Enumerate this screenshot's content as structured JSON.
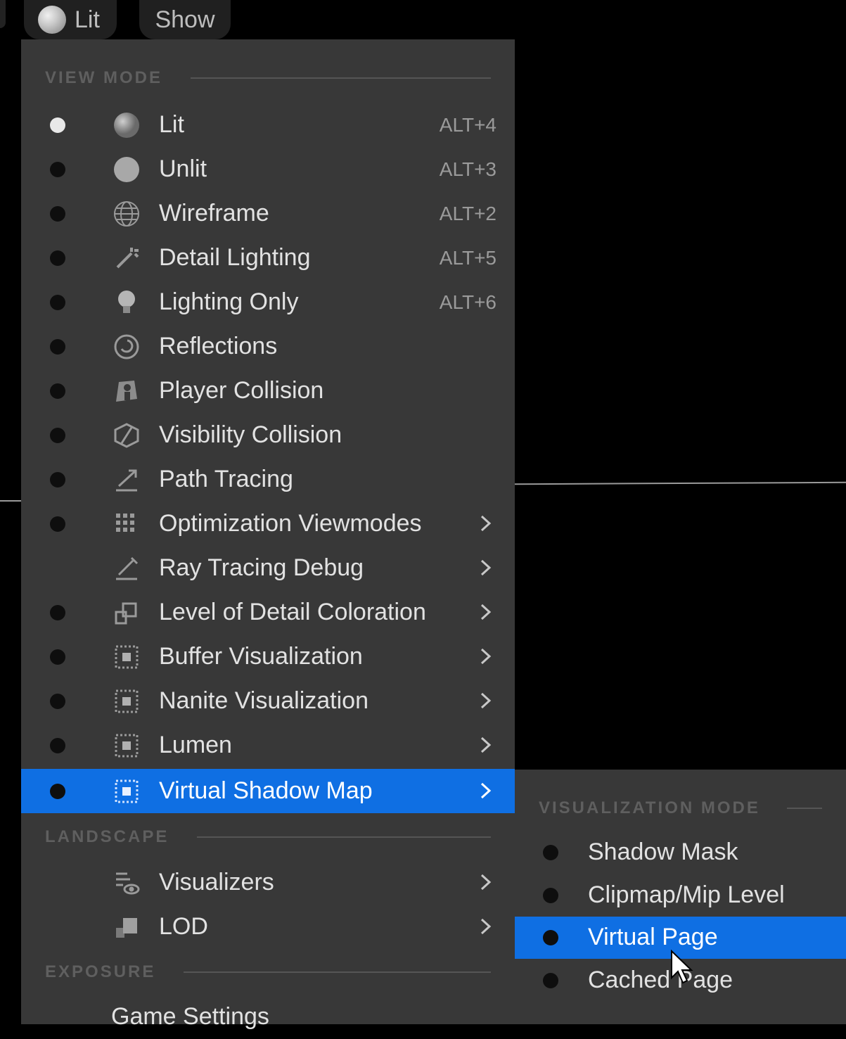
{
  "toolbar": {
    "lit_label": "Lit",
    "show_label": "Show"
  },
  "menu": {
    "sections": {
      "view_mode": "VIEW MODE",
      "landscape": "LANDSCAPE",
      "exposure": "EXPOSURE"
    },
    "items": [
      {
        "label": "Lit",
        "shortcut": "ALT+4",
        "selected": true,
        "icon": "lit-sphere-icon"
      },
      {
        "label": "Unlit",
        "shortcut": "ALT+3",
        "selected": false,
        "icon": "unlit-sphere-icon"
      },
      {
        "label": "Wireframe",
        "shortcut": "ALT+2",
        "selected": false,
        "icon": "wireframe-sphere-icon"
      },
      {
        "label": "Detail Lighting",
        "shortcut": "ALT+5",
        "selected": false,
        "icon": "detail-lighting-icon"
      },
      {
        "label": "Lighting Only",
        "shortcut": "ALT+6",
        "selected": false,
        "icon": "light-bulb-icon"
      },
      {
        "label": "Reflections",
        "shortcut": "",
        "selected": false,
        "icon": "reflections-icon"
      },
      {
        "label": "Player Collision",
        "shortcut": "",
        "selected": false,
        "icon": "player-collision-icon"
      },
      {
        "label": "Visibility Collision",
        "shortcut": "",
        "selected": false,
        "icon": "visibility-collision-icon"
      },
      {
        "label": "Path Tracing",
        "shortcut": "",
        "selected": false,
        "icon": "path-tracing-icon"
      },
      {
        "label": "Optimization Viewmodes",
        "shortcut": "",
        "selected": false,
        "icon": "grid-icon",
        "submenu": true
      },
      {
        "label": "Ray Tracing Debug",
        "shortcut": "",
        "selected": false,
        "icon": "ray-tracing-icon",
        "submenu": true,
        "no_dot": true
      },
      {
        "label": "Level of Detail Coloration",
        "shortcut": "",
        "selected": false,
        "icon": "lod-coloration-icon",
        "submenu": true
      },
      {
        "label": "Buffer Visualization",
        "shortcut": "",
        "selected": false,
        "icon": "visualization-icon",
        "submenu": true
      },
      {
        "label": "Nanite Visualization",
        "shortcut": "",
        "selected": false,
        "icon": "visualization-icon",
        "submenu": true
      },
      {
        "label": "Lumen",
        "shortcut": "",
        "selected": false,
        "icon": "visualization-icon",
        "submenu": true
      },
      {
        "label": "Virtual Shadow Map",
        "shortcut": "",
        "selected": false,
        "icon": "visualization-icon",
        "submenu": true,
        "highlighted": true
      }
    ],
    "landscape_items": [
      {
        "label": "Visualizers",
        "icon": "visualizers-icon",
        "submenu": true
      },
      {
        "label": "LOD",
        "icon": "lod-icon",
        "submenu": true
      }
    ],
    "exposure_items": [
      {
        "label": "Game Settings"
      }
    ]
  },
  "submenu": {
    "section": "VISUALIZATION MODE",
    "items": [
      {
        "label": "Shadow Mask"
      },
      {
        "label": "Clipmap/Mip Level"
      },
      {
        "label": "Virtual Page",
        "highlighted": true
      },
      {
        "label": "Cached Page"
      }
    ]
  }
}
